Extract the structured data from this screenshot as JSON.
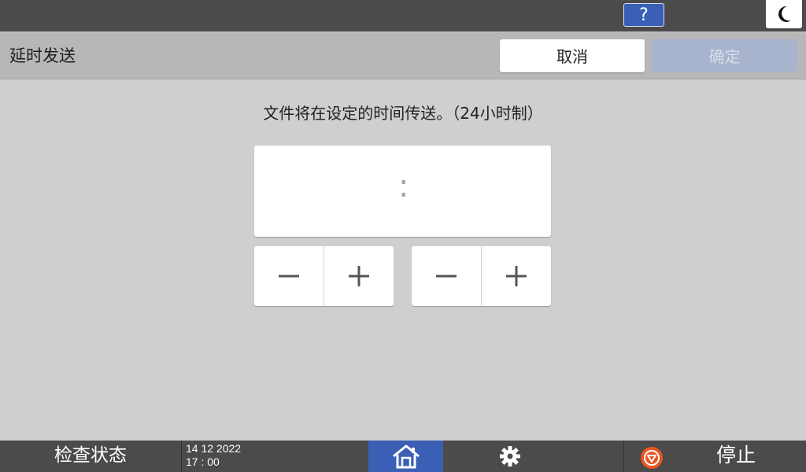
{
  "topbar": {
    "help_label": "?",
    "help_icon": "question-icon",
    "sleep_icon": "moon-icon"
  },
  "header": {
    "title": "延时发送",
    "cancel_label": "取消",
    "ok_label": "确定"
  },
  "main": {
    "instruction": "文件将在设定的时间传送。（24小时制）",
    "time_separator": ":",
    "hour_minus_icon": "minus-icon",
    "hour_plus_icon": "plus-icon",
    "minute_minus_icon": "minus-icon",
    "minute_plus_icon": "plus-icon"
  },
  "bottombar": {
    "status_label": "检查状态",
    "date": "14 12 2022",
    "time": "17 : 00",
    "home_icon": "home-icon",
    "settings_icon": "gear-icon",
    "stop_icon": "stop-icon",
    "stop_label": "停止"
  },
  "colors": {
    "accent_blue": "#3a5fb5",
    "disabled_button": "#a8b4cd",
    "stop_orange": "#e8551f",
    "bar_dark": "#4b4b4b"
  }
}
